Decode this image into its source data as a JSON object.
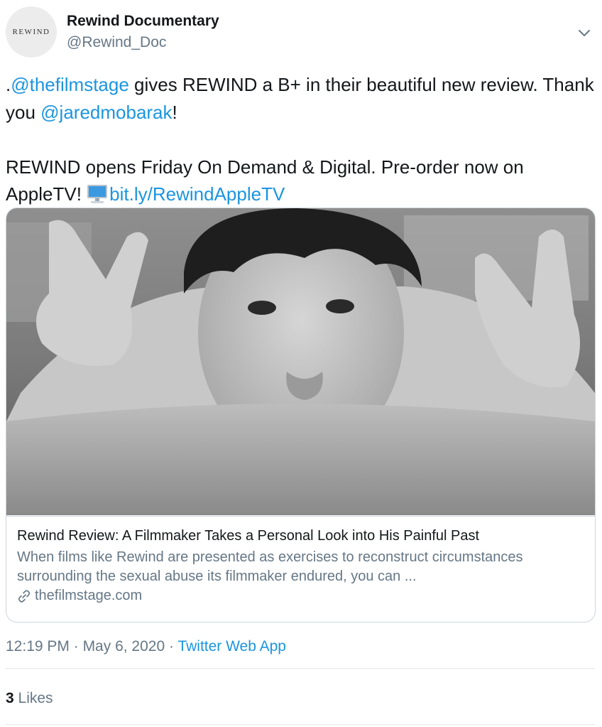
{
  "author": {
    "avatar_text": "REWIND",
    "name": "Rewind Documentary",
    "handle": "@Rewind_Doc"
  },
  "tweet": {
    "mention1": "@thefilmstage",
    "text1": " gives REWIND a B+ in their beautiful new review. Thank you ",
    "prefix": ".",
    "mention2": "@jaredmobarak",
    "text2": "!",
    "text3": "REWIND opens Friday On Demand & Digital. Pre-order now on AppleTV! ",
    "link": "bit.ly/RewindAppleTV",
    "emoji": "desktop-computer-emoji"
  },
  "card": {
    "title": "Rewind Review: A Filmmaker Takes a Personal Look into His Painful Past",
    "description": "When films like Rewind are presented as exercises to reconstruct circumstances surrounding the sexual abuse its filmmaker endured, you can ...",
    "domain": "thefilmstage.com"
  },
  "meta": {
    "time": "12:19 PM",
    "sep1": " · ",
    "date": "May 6, 2020",
    "sep2": " · ",
    "source": "Twitter Web App"
  },
  "stats": {
    "likes_count": "3",
    "likes_label": " Likes"
  },
  "colors": {
    "link": "#1b95e0",
    "text": "#14171a",
    "secondary": "#657786",
    "border": "#ccd6dd"
  },
  "icons": {
    "caret": "chevron-down-icon",
    "domain": "link-icon"
  }
}
